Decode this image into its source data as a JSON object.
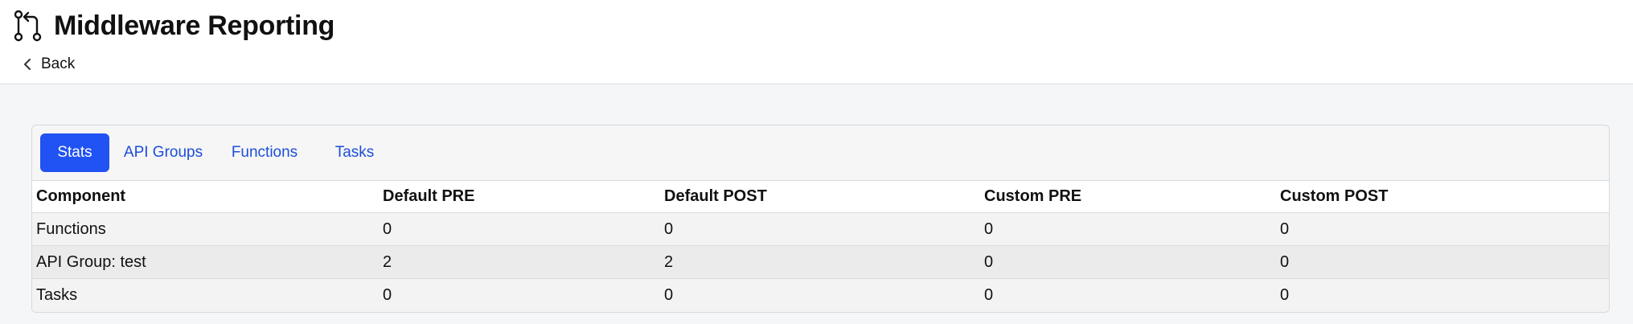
{
  "header": {
    "title": "Middleware Reporting",
    "title_icon": "git-pull-request-icon",
    "back_label": "Back",
    "back_icon": "chevron-left-icon"
  },
  "tabs": [
    {
      "label": "Stats",
      "active": true
    },
    {
      "label": "API Groups",
      "active": false
    },
    {
      "label": "Functions",
      "active": false
    },
    {
      "label": "Tasks",
      "active": false
    }
  ],
  "table": {
    "columns": [
      "Component",
      "Default PRE",
      "Default POST",
      "Custom PRE",
      "Custom POST"
    ],
    "rows": [
      [
        "Functions",
        "0",
        "0",
        "0",
        "0"
      ],
      [
        "API Group: test",
        "2",
        "2",
        "0",
        "0"
      ],
      [
        "Tasks",
        "0",
        "0",
        "0",
        "0"
      ]
    ]
  },
  "colors": {
    "accent": "#2152f3",
    "link": "#1d4ed8",
    "page_bg": "#f5f6f8"
  }
}
